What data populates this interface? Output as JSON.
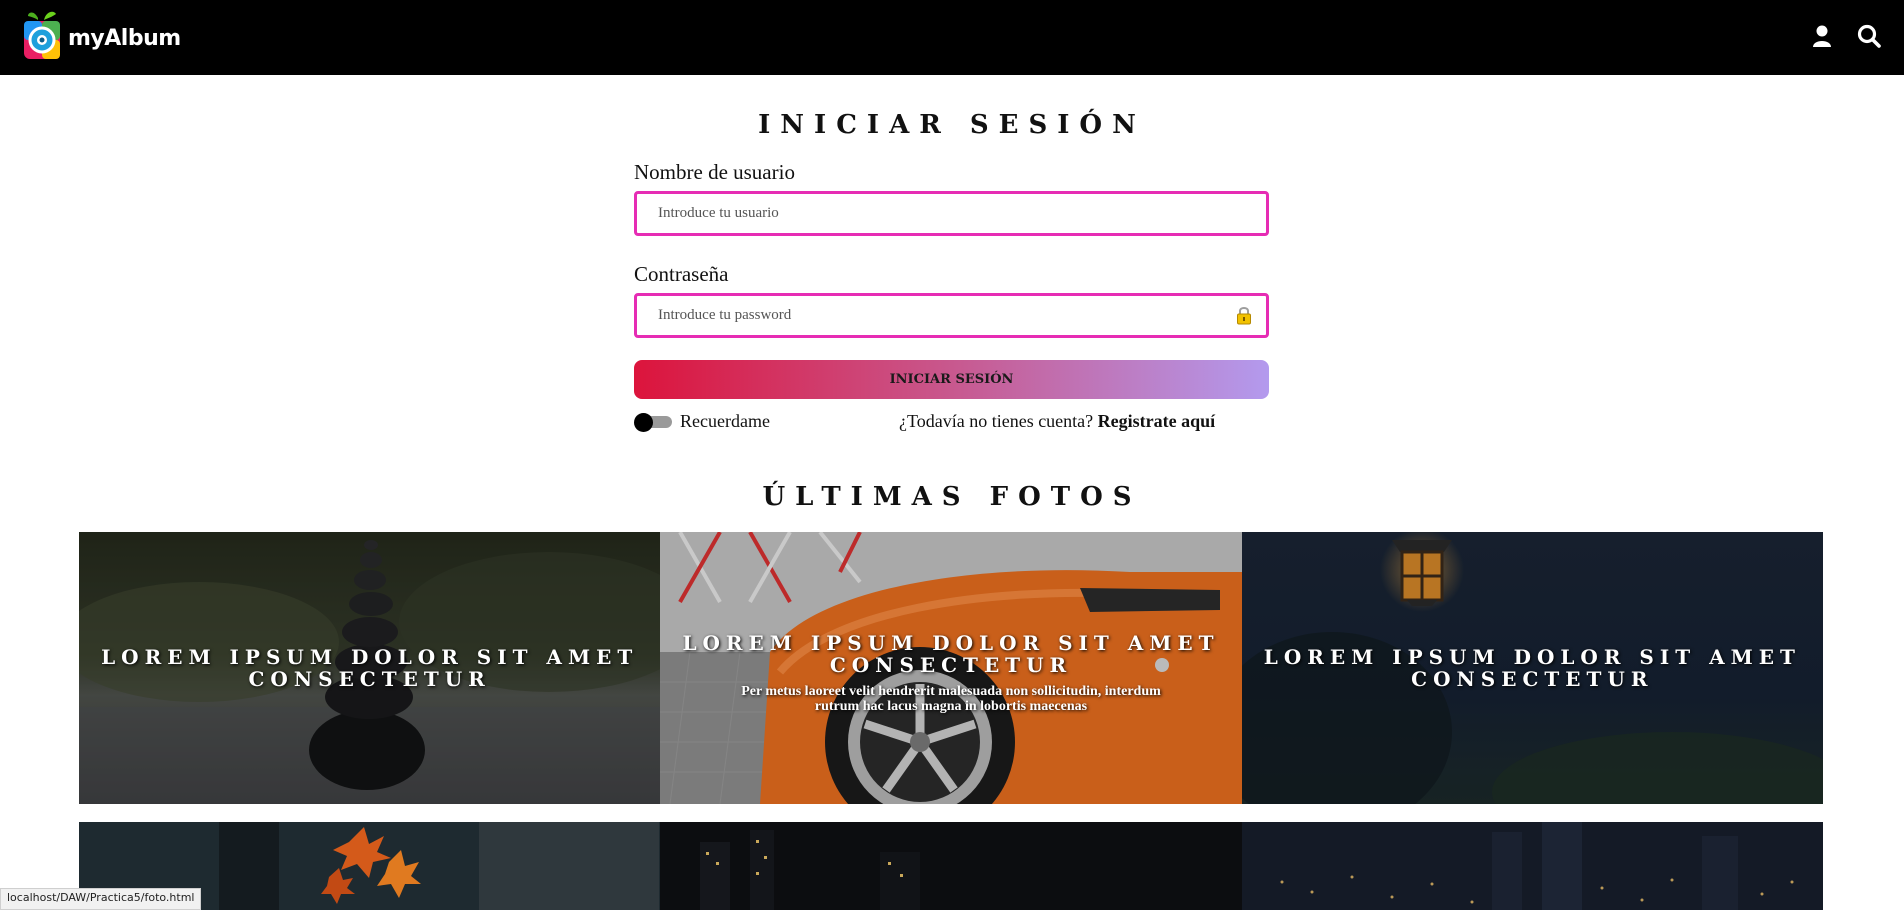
{
  "header": {
    "brand": "myAlbum",
    "icons": [
      "user-icon",
      "search-icon"
    ]
  },
  "login": {
    "title": "INICIAR SESIÓN",
    "username_label": "Nombre de usuario",
    "username_placeholder": "Introduce tu usuario",
    "password_label": "Contraseña",
    "password_placeholder": "Introduce tu password",
    "submit_label": "INICIAR SESIÓN",
    "remember_label": "Recuerdame",
    "no_account_text": "¿Todavía no tienes cuenta?",
    "register_link": "Registrate aquí"
  },
  "latest": {
    "title": "ÚLTIMAS FOTOS",
    "photos": [
      {
        "title": "LOREM IPSUM DOLOR SIT AMET CONSECTETUR",
        "subtitle": ""
      },
      {
        "title": "LOREM IPSUM DOLOR SIT AMET CONSECTETUR",
        "subtitle": "Per metus laoreet velit hendrerit malesuada non sollicitudin, interdum rutrum hac lacus magna in lobortis maecenas"
      },
      {
        "title": "LOREM IPSUM DOLOR SIT AMET CONSECTETUR",
        "subtitle": ""
      }
    ]
  },
  "status_url": "localhost/DAW/Practica5/foto.html",
  "colors": {
    "header_bg": "#000000",
    "input_border": "#e62cb4",
    "button_gradient_start": "#dc143c",
    "button_gradient_end": "#b39aee"
  }
}
